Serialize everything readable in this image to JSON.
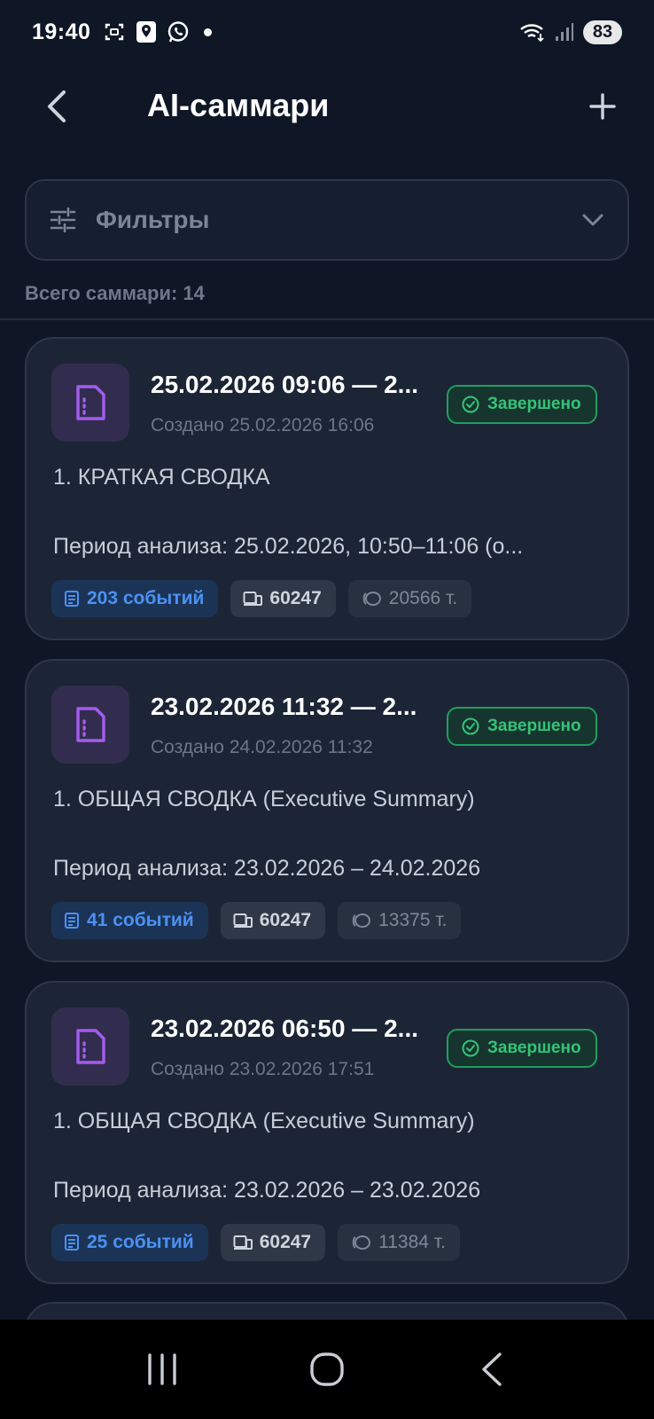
{
  "status_bar": {
    "time": "19:40",
    "battery": "83",
    "icons_left": [
      "screenshot-icon",
      "location-icon",
      "whatsapp-icon",
      "dot-icon"
    ],
    "icons_right": [
      "wifi-icon",
      "signal-icon",
      "battery-icon"
    ]
  },
  "header": {
    "title": "AI-саммари"
  },
  "filters": {
    "label": "Фильтры"
  },
  "summary": {
    "total": "Всего саммари: 14"
  },
  "cards": [
    {
      "title": "25.02.2026 09:06 — 2...",
      "created": "Создано 25.02.2026 16:06",
      "status": "Завершено",
      "line1": "1. КРАТКАЯ СВОДКА",
      "line2": "Период анализа: 25.02.2026, 10:50–11:06 (о...",
      "events": "203 событий",
      "device": "60247",
      "tokens": "20566 т."
    },
    {
      "title": "23.02.2026 11:32 — 2...",
      "created": "Создано 24.02.2026 11:32",
      "status": "Завершено",
      "line1": "1. ОБЩАЯ СВОДКА (Executive Summary)",
      "line2": "Период анализа: 23.02.2026 – 24.02.2026",
      "events": "41 событий",
      "device": "60247",
      "tokens": "13375 т."
    },
    {
      "title": "23.02.2026 06:50 — 2...",
      "created": "Создано 23.02.2026 17:51",
      "status": "Завершено",
      "line1": "1. ОБЩАЯ СВОДКА (Executive Summary)",
      "line2": "Период анализа: 23.02.2026 – 23.02.2026",
      "events": "25 событий",
      "device": "60247",
      "tokens": "11384 т."
    }
  ],
  "colors": {
    "background": "#0f1625",
    "card": "#1c2535",
    "status_green": "#34c477",
    "events_blue": "#4d91f2",
    "doc_purple": "#a45cf0"
  }
}
